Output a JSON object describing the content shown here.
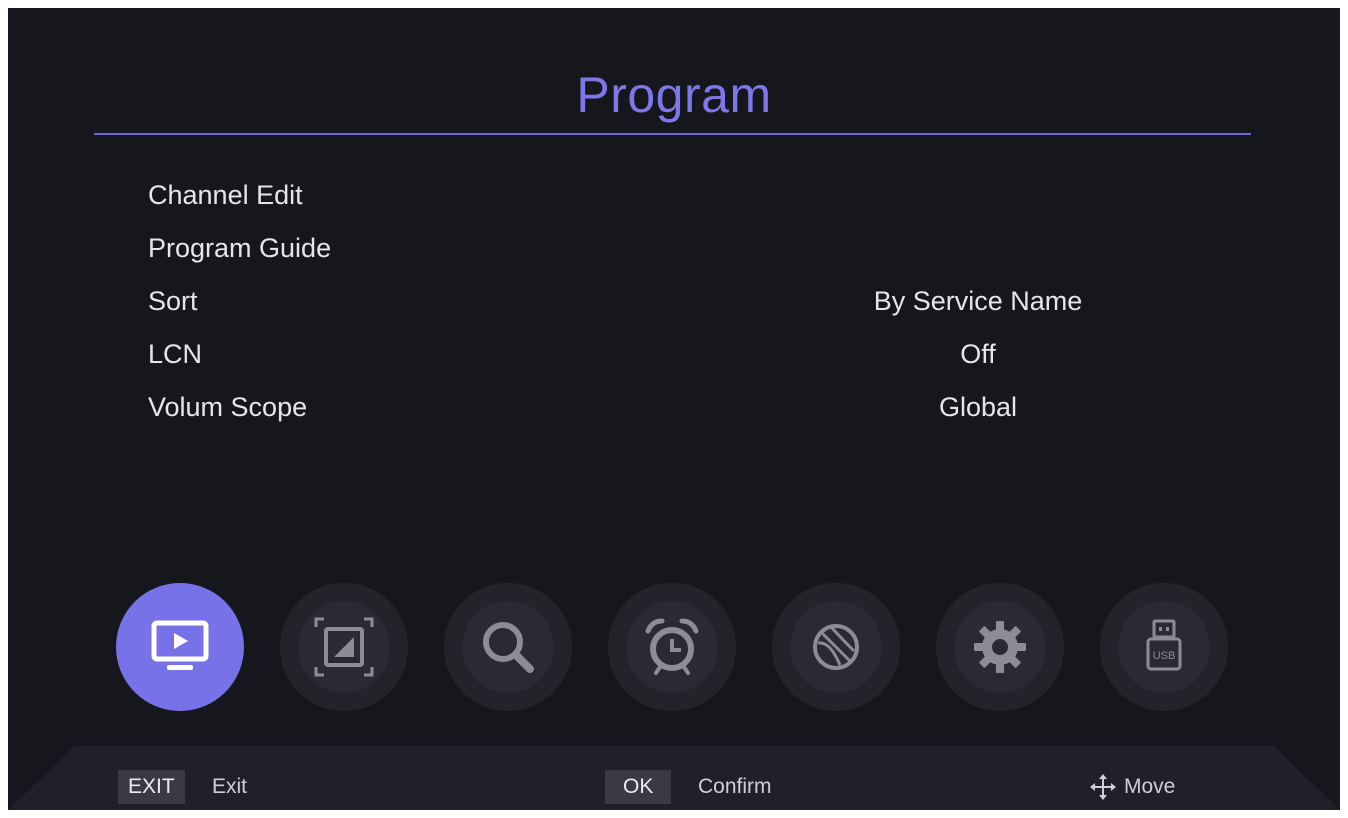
{
  "page": {
    "title": "Program",
    "accent_color": "#7c78ea"
  },
  "menu": {
    "items": [
      {
        "label": "Channel Edit",
        "value": ""
      },
      {
        "label": "Program Guide",
        "value": ""
      },
      {
        "label": "Sort",
        "value": "By Service Name"
      },
      {
        "label": "LCN",
        "value": "Off"
      },
      {
        "label": "Volum Scope",
        "value": "Global"
      }
    ]
  },
  "icon_bar": {
    "icons": [
      {
        "name": "tv-play-icon",
        "active": true
      },
      {
        "name": "picture-icon",
        "active": false
      },
      {
        "name": "search-icon",
        "active": false
      },
      {
        "name": "alarm-clock-icon",
        "active": false
      },
      {
        "name": "globe-ball-icon",
        "active": false
      },
      {
        "name": "gear-icon",
        "active": false
      },
      {
        "name": "usb-icon",
        "active": false
      }
    ],
    "usb_text": "USB"
  },
  "footer": {
    "exit_key": "EXIT",
    "exit_label": "Exit",
    "ok_key": "OK",
    "ok_label": "Confirm",
    "move_label": "Move"
  }
}
